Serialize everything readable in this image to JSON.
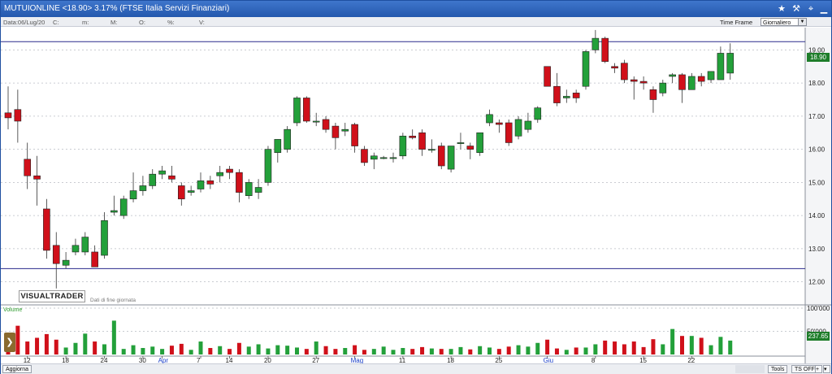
{
  "title": "MUTUIONLINE <18.90> 3.17%  (FTSE Italia Servizi Finanziari)",
  "info": {
    "data": "Data:06/Lug/20",
    "c": "C:",
    "m": "m:",
    "M": "M:",
    "o": "O:",
    "pct": "%:",
    "v": "V:",
    "timeframe_label": "Time Frame",
    "timeframe_value": "Giornaliero"
  },
  "branding": {
    "logo": "VISUALTRADER",
    "note": "Dati di fine giornata"
  },
  "volume_label": "Volume",
  "last_price_tag": "18.90",
  "volume_tag": "237.65",
  "bottom": {
    "aggiorna": "Aggiorna",
    "tools": "Tools",
    "ts": "TS OFF"
  },
  "colors": {
    "up": "#23a03a",
    "down": "#d0101a",
    "hline": "#2a2a8c",
    "title_bg": "#2f64bd"
  },
  "icons": [
    "star-icon",
    "hammer-icon",
    "pin-icon",
    "minimize-icon",
    "maximize-icon",
    "close-icon"
  ],
  "chart_data": {
    "type": "candlestick",
    "y_ticks": [
      "19.00",
      "18.00",
      "17.00",
      "16.00",
      "15.00",
      "14.00",
      "13.00",
      "12.00"
    ],
    "y_range": [
      11.5,
      19.5
    ],
    "vol_ticks": [
      "100'000",
      "50'000"
    ],
    "x_labels": [
      {
        "label": "12",
        "i": 2,
        "month": false
      },
      {
        "label": "18",
        "i": 6,
        "month": false
      },
      {
        "label": "24",
        "i": 10,
        "month": false
      },
      {
        "label": "30",
        "i": 14,
        "month": false
      },
      {
        "label": "Apr",
        "i": 16,
        "month": true
      },
      {
        "label": "7",
        "i": 20,
        "month": false
      },
      {
        "label": "14",
        "i": 23,
        "month": false
      },
      {
        "label": "20",
        "i": 27,
        "month": false
      },
      {
        "label": "27",
        "i": 32,
        "month": false
      },
      {
        "label": "Mag",
        "i": 36,
        "month": true
      },
      {
        "label": "11",
        "i": 41,
        "month": false
      },
      {
        "label": "18",
        "i": 46,
        "month": false
      },
      {
        "label": "25",
        "i": 51,
        "month": false
      },
      {
        "label": "Giu",
        "i": 56,
        "month": true
      },
      {
        "label": "8",
        "i": 61,
        "month": false
      },
      {
        "label": "15",
        "i": 66,
        "month": false
      },
      {
        "label": "22",
        "i": 71,
        "month": false
      }
    ],
    "hlines": [
      19.25,
      12.4
    ],
    "candles": [
      {
        "o": 17.1,
        "h": 17.9,
        "l": 16.6,
        "c": 16.95,
        "v": 40
      },
      {
        "o": 17.2,
        "h": 17.8,
        "l": 16.2,
        "c": 16.85,
        "v": 62
      },
      {
        "o": 15.7,
        "h": 16.2,
        "l": 14.8,
        "c": 15.2,
        "v": 28
      },
      {
        "o": 15.2,
        "h": 15.8,
        "l": 14.3,
        "c": 15.1,
        "v": 36
      },
      {
        "o": 14.2,
        "h": 14.5,
        "l": 12.7,
        "c": 12.95,
        "v": 44
      },
      {
        "o": 13.1,
        "h": 13.5,
        "l": 11.8,
        "c": 12.55,
        "v": 32
      },
      {
        "o": 12.5,
        "h": 12.9,
        "l": 12.4,
        "c": 12.65,
        "v": 15
      },
      {
        "o": 12.9,
        "h": 13.3,
        "l": 12.8,
        "c": 13.1,
        "v": 25
      },
      {
        "o": 12.9,
        "h": 13.5,
        "l": 12.8,
        "c": 13.35,
        "v": 45
      },
      {
        "o": 12.9,
        "h": 13.1,
        "l": 12.45,
        "c": 12.45,
        "v": 28
      },
      {
        "o": 12.8,
        "h": 14.1,
        "l": 12.7,
        "c": 13.85,
        "v": 22
      },
      {
        "o": 14.1,
        "h": 14.6,
        "l": 14.0,
        "c": 14.15,
        "v": 73
      },
      {
        "o": 14.0,
        "h": 14.6,
        "l": 13.9,
        "c": 14.5,
        "v": 12
      },
      {
        "o": 14.5,
        "h": 15.3,
        "l": 14.4,
        "c": 14.75,
        "v": 20
      },
      {
        "o": 14.75,
        "h": 15.2,
        "l": 14.6,
        "c": 14.9,
        "v": 14
      },
      {
        "o": 14.9,
        "h": 15.4,
        "l": 14.8,
        "c": 15.25,
        "v": 17
      },
      {
        "o": 15.25,
        "h": 15.5,
        "l": 15.1,
        "c": 15.35,
        "v": 12
      },
      {
        "o": 15.2,
        "h": 15.5,
        "l": 15.0,
        "c": 15.1,
        "v": 19
      },
      {
        "o": 14.9,
        "h": 15.0,
        "l": 14.3,
        "c": 14.5,
        "v": 23
      },
      {
        "o": 14.7,
        "h": 14.9,
        "l": 14.6,
        "c": 14.75,
        "v": 10
      },
      {
        "o": 14.8,
        "h": 15.3,
        "l": 14.7,
        "c": 15.05,
        "v": 28
      },
      {
        "o": 15.05,
        "h": 15.2,
        "l": 14.8,
        "c": 14.95,
        "v": 14
      },
      {
        "o": 15.2,
        "h": 15.5,
        "l": 15.0,
        "c": 15.3,
        "v": 18
      },
      {
        "o": 15.4,
        "h": 15.5,
        "l": 15.1,
        "c": 15.3,
        "v": 12
      },
      {
        "o": 15.3,
        "h": 15.4,
        "l": 14.4,
        "c": 14.7,
        "v": 25
      },
      {
        "o": 14.6,
        "h": 15.1,
        "l": 14.5,
        "c": 15.0,
        "v": 17
      },
      {
        "o": 14.7,
        "h": 15.1,
        "l": 14.5,
        "c": 14.85,
        "v": 22
      },
      {
        "o": 15.0,
        "h": 16.1,
        "l": 14.9,
        "c": 16.0,
        "v": 13
      },
      {
        "o": 15.9,
        "h": 16.3,
        "l": 15.6,
        "c": 16.3,
        "v": 20
      },
      {
        "o": 16.0,
        "h": 16.7,
        "l": 15.9,
        "c": 16.6,
        "v": 19
      },
      {
        "o": 16.8,
        "h": 17.6,
        "l": 16.7,
        "c": 17.55,
        "v": 15
      },
      {
        "o": 17.55,
        "h": 17.6,
        "l": 16.8,
        "c": 16.85,
        "v": 12
      },
      {
        "o": 16.85,
        "h": 17.1,
        "l": 16.7,
        "c": 16.85,
        "v": 28
      },
      {
        "o": 16.9,
        "h": 17.0,
        "l": 16.5,
        "c": 16.6,
        "v": 18
      },
      {
        "o": 16.7,
        "h": 16.8,
        "l": 16.0,
        "c": 16.35,
        "v": 12
      },
      {
        "o": 16.55,
        "h": 16.8,
        "l": 16.4,
        "c": 16.6,
        "v": 14
      },
      {
        "o": 16.75,
        "h": 16.8,
        "l": 15.9,
        "c": 16.1,
        "v": 20
      },
      {
        "o": 16.0,
        "h": 16.1,
        "l": 15.5,
        "c": 15.6,
        "v": 10
      },
      {
        "o": 15.7,
        "h": 15.9,
        "l": 15.4,
        "c": 15.8,
        "v": 12
      },
      {
        "o": 15.75,
        "h": 15.8,
        "l": 15.7,
        "c": 15.75,
        "v": 17
      },
      {
        "o": 15.75,
        "h": 15.9,
        "l": 15.6,
        "c": 15.75,
        "v": 10
      },
      {
        "o": 15.8,
        "h": 16.5,
        "l": 15.7,
        "c": 16.4,
        "v": 14
      },
      {
        "o": 16.4,
        "h": 16.6,
        "l": 16.3,
        "c": 16.35,
        "v": 12
      },
      {
        "o": 16.5,
        "h": 16.6,
        "l": 15.8,
        "c": 16.0,
        "v": 16
      },
      {
        "o": 16.0,
        "h": 16.3,
        "l": 15.9,
        "c": 16.0,
        "v": 13
      },
      {
        "o": 16.1,
        "h": 16.2,
        "l": 15.4,
        "c": 15.5,
        "v": 12
      },
      {
        "o": 15.4,
        "h": 16.1,
        "l": 15.3,
        "c": 16.1,
        "v": 12
      },
      {
        "o": 16.2,
        "h": 16.5,
        "l": 16.0,
        "c": 16.2,
        "v": 16
      },
      {
        "o": 16.1,
        "h": 16.2,
        "l": 15.7,
        "c": 16.0,
        "v": 11
      },
      {
        "o": 15.9,
        "h": 16.5,
        "l": 15.8,
        "c": 16.5,
        "v": 18
      },
      {
        "o": 16.8,
        "h": 17.2,
        "l": 16.7,
        "c": 17.05,
        "v": 15
      },
      {
        "o": 16.8,
        "h": 16.9,
        "l": 16.5,
        "c": 16.75,
        "v": 12
      },
      {
        "o": 16.8,
        "h": 16.9,
        "l": 16.1,
        "c": 16.2,
        "v": 17
      },
      {
        "o": 16.4,
        "h": 17.0,
        "l": 16.3,
        "c": 16.9,
        "v": 20
      },
      {
        "o": 16.6,
        "h": 17.1,
        "l": 16.5,
        "c": 16.85,
        "v": 17
      },
      {
        "o": 16.9,
        "h": 17.3,
        "l": 16.8,
        "c": 17.25,
        "v": 25
      },
      {
        "o": 18.5,
        "h": 18.5,
        "l": 17.9,
        "c": 17.9,
        "v": 32
      },
      {
        "o": 17.9,
        "h": 18.3,
        "l": 17.3,
        "c": 17.4,
        "v": 13
      },
      {
        "o": 17.55,
        "h": 17.8,
        "l": 17.4,
        "c": 17.6,
        "v": 10
      },
      {
        "o": 17.7,
        "h": 17.8,
        "l": 17.4,
        "c": 17.55,
        "v": 15
      },
      {
        "o": 17.9,
        "h": 19.0,
        "l": 17.8,
        "c": 18.95,
        "v": 15
      },
      {
        "o": 19.0,
        "h": 19.6,
        "l": 18.9,
        "c": 19.35,
        "v": 22
      },
      {
        "o": 19.35,
        "h": 19.4,
        "l": 18.6,
        "c": 18.65,
        "v": 30
      },
      {
        "o": 18.5,
        "h": 18.6,
        "l": 18.3,
        "c": 18.45,
        "v": 28
      },
      {
        "o": 18.6,
        "h": 18.7,
        "l": 18.0,
        "c": 18.1,
        "v": 22
      },
      {
        "o": 18.1,
        "h": 18.2,
        "l": 17.5,
        "c": 18.05,
        "v": 28
      },
      {
        "o": 18.05,
        "h": 18.2,
        "l": 17.8,
        "c": 18.0,
        "v": 16
      },
      {
        "o": 17.8,
        "h": 17.9,
        "l": 17.1,
        "c": 17.5,
        "v": 33
      },
      {
        "o": 17.7,
        "h": 18.1,
        "l": 17.6,
        "c": 18.0,
        "v": 22
      },
      {
        "o": 18.2,
        "h": 18.3,
        "l": 18.0,
        "c": 18.25,
        "v": 55
      },
      {
        "o": 18.25,
        "h": 18.3,
        "l": 17.4,
        "c": 17.8,
        "v": 40
      },
      {
        "o": 17.8,
        "h": 18.3,
        "l": 17.8,
        "c": 18.2,
        "v": 40
      },
      {
        "o": 18.2,
        "h": 18.3,
        "l": 17.9,
        "c": 18.05,
        "v": 36
      },
      {
        "o": 18.1,
        "h": 18.3,
        "l": 18.0,
        "c": 18.35,
        "v": 20
      },
      {
        "o": 18.1,
        "h": 19.1,
        "l": 18.1,
        "c": 18.9,
        "v": 38
      },
      {
        "o": 18.3,
        "h": 19.2,
        "l": 18.1,
        "c": 18.9,
        "v": 30
      }
    ]
  }
}
